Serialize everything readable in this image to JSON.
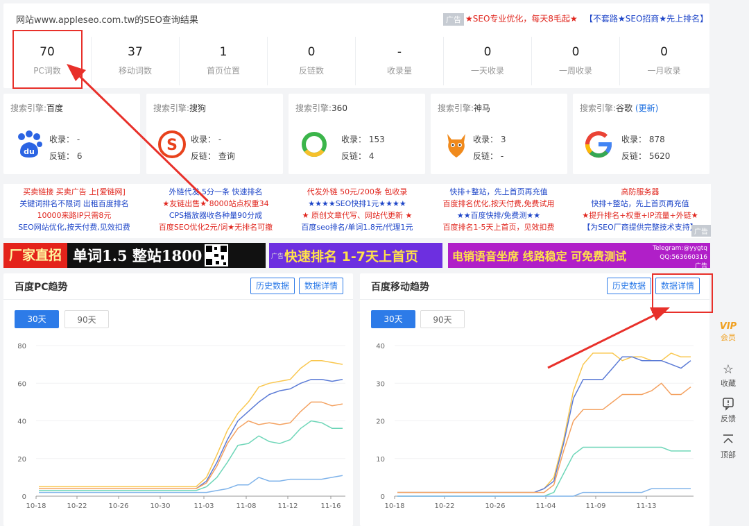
{
  "header": {
    "title": "网站www.appleseo.com.tw的SEO查询结果",
    "ad_tag": "广告",
    "ad1": "★SEO专业优化，每天8毛起★",
    "ad2": "【不套路★SEO招商★先上排名】"
  },
  "stats": [
    {
      "value": "70",
      "label": "PC词数"
    },
    {
      "value": "37",
      "label": "移动词数"
    },
    {
      "value": "1",
      "label": "首页位置"
    },
    {
      "value": "0",
      "label": "反链数"
    },
    {
      "value": "-",
      "label": "收录量"
    },
    {
      "value": "0",
      "label": "一天收录"
    },
    {
      "value": "0",
      "label": "一周收录"
    },
    {
      "value": "0",
      "label": "一月收录"
    }
  ],
  "engines": [
    {
      "prefix": "搜索引擎:",
      "name": "百度",
      "extra": "",
      "index": "收录： -",
      "links": "反链： 6",
      "icon": "baidu-icon"
    },
    {
      "prefix": "搜索引擎:",
      "name": "搜狗",
      "extra": "",
      "index": "收录： -",
      "links": "反链： 查询",
      "icon": "sogou-icon"
    },
    {
      "prefix": "搜索引擎:",
      "name": "360",
      "extra": "",
      "index": "收录： 153",
      "links": "反链： 4",
      "icon": "360-icon"
    },
    {
      "prefix": "搜索引擎:",
      "name": "神马",
      "extra": "",
      "index": "收录： 3",
      "links": "反链： -",
      "icon": "shenma-icon"
    },
    {
      "prefix": "搜索引擎:",
      "name": "谷歌",
      "extra": "(更新)",
      "index": "收录： 878",
      "links": "反链： 5620",
      "icon": "google-icon"
    }
  ],
  "ad_columns": [
    [
      "买卖链接 买卖广告 上[爱链网]",
      "关键词排名不限词 出租百度排名",
      "10000来路IP只需8元",
      "SEO网站优化,按天付费,见效扣费"
    ],
    [
      "外链代发 5分一条 快速排名",
      "★友链出售★ 8000站点权重34",
      "CPS播放器收各种量90分成",
      "百度SEO优化2元/词★无排名可撤"
    ],
    [
      "代发外链 50元/200条 包收录",
      "★★★★SEO快排1元★★★★",
      "★ 原创文章代写、网站代更新 ★",
      "百度seo排名/单词1.8元/代理1元"
    ],
    [
      "快排+整站，先上首页再充值",
      "百度排名优化,按天付费,免费试用",
      "★★百度快排/免费测★★",
      "百度排名1-5天上首页，见效扣费"
    ],
    [
      "高防服务器",
      "快排+整站，先上首页再充值",
      "★提升排名+权重+IP流量+外链★",
      "【为SEO厂商提供完整技术支持】"
    ]
  ],
  "ad_tag_bottom": "广告",
  "banners": {
    "b1a": "厂家直招",
    "b1b": "单词1.5 整站1800",
    "b2": "快速排名 1-7天上首页",
    "b3": "电销语音坐席 线路稳定 可免费测试",
    "b3_tel": "Telegram:@yygtq",
    "b3_qq": "QQ:563660316",
    "b3_ad": "广告",
    "b2_ad": "广告"
  },
  "pc_panel": {
    "title": "百度PC趋势",
    "btn_history": "历史数据",
    "btn_detail": "数据详情",
    "tab30": "30天",
    "tab90": "90天"
  },
  "mobile_panel": {
    "title": "百度移动趋势",
    "btn_history": "历史数据",
    "btn_detail": "数据详情",
    "tab30": "30天",
    "tab90": "90天"
  },
  "sidebar": {
    "vip": "VIP",
    "member": "会员",
    "favorite": "收藏",
    "feedback": "反馈",
    "top": "顶部"
  },
  "chart_data": [
    {
      "type": "line",
      "title": "百度PC趋势",
      "x": [
        "10-18",
        "10-22",
        "10-26",
        "10-30",
        "11-03",
        "11-08",
        "11-12",
        "11-16"
      ],
      "ylim": [
        0,
        80
      ],
      "yticks": [
        0,
        20,
        40,
        60,
        80
      ],
      "series": [
        {
          "color": "#f9c74f",
          "values": [
            5,
            5,
            5,
            5,
            5,
            5,
            5,
            5,
            5,
            5,
            5,
            5,
            5,
            5,
            5,
            5,
            10,
            22,
            35,
            44,
            50,
            58,
            60,
            61,
            62,
            68,
            72,
            72,
            71,
            70
          ]
        },
        {
          "color": "#5b7bd6",
          "values": [
            4,
            4,
            4,
            4,
            4,
            4,
            4,
            4,
            4,
            4,
            4,
            4,
            4,
            4,
            4,
            4,
            8,
            18,
            30,
            40,
            45,
            50,
            54,
            56,
            57,
            60,
            62,
            62,
            61,
            62
          ]
        },
        {
          "color": "#f4a261",
          "values": [
            4,
            4,
            4,
            4,
            4,
            4,
            4,
            4,
            4,
            4,
            4,
            4,
            4,
            4,
            4,
            4,
            7,
            16,
            28,
            36,
            40,
            38,
            39,
            38,
            39,
            45,
            50,
            50,
            48,
            49
          ]
        },
        {
          "color": "#6ed6b8",
          "values": [
            3,
            3,
            3,
            3,
            3,
            3,
            3,
            3,
            3,
            3,
            3,
            3,
            3,
            3,
            3,
            3,
            5,
            10,
            18,
            27,
            28,
            32,
            29,
            28,
            30,
            36,
            40,
            39,
            36,
            36
          ]
        },
        {
          "color": "#7fb3ea",
          "values": [
            2,
            2,
            2,
            2,
            2,
            2,
            2,
            2,
            2,
            2,
            2,
            2,
            2,
            2,
            2,
            2,
            2,
            3,
            4,
            6,
            6,
            10,
            8,
            8,
            9,
            9,
            9,
            9,
            10,
            11
          ]
        }
      ]
    },
    {
      "type": "line",
      "title": "百度移动趋势",
      "x": [
        "10-18",
        "10-22",
        "10-26",
        "11-04",
        "11-09",
        "11-13"
      ],
      "ylim": [
        0,
        40
      ],
      "yticks": [
        0,
        10,
        20,
        30,
        40
      ],
      "series": [
        {
          "color": "#f9c74f",
          "values": [
            1,
            1,
            1,
            1,
            1,
            1,
            1,
            1,
            1,
            1,
            1,
            1,
            1,
            1,
            1,
            2,
            5,
            15,
            28,
            35,
            38,
            38,
            38,
            36,
            37,
            37,
            36,
            36,
            38,
            37,
            37
          ]
        },
        {
          "color": "#5b7bd6",
          "values": [
            1,
            1,
            1,
            1,
            1,
            1,
            1,
            1,
            1,
            1,
            1,
            1,
            1,
            1,
            1,
            2,
            4,
            14,
            26,
            31,
            31,
            31,
            34,
            37,
            37,
            36,
            36,
            36,
            35,
            34,
            36
          ]
        },
        {
          "color": "#f4a261",
          "values": [
            1,
            1,
            1,
            1,
            1,
            1,
            1,
            1,
            1,
            1,
            1,
            1,
            1,
            1,
            1,
            1,
            3,
            12,
            20,
            23,
            23,
            23,
            25,
            27,
            27,
            27,
            28,
            30,
            27,
            27,
            29
          ]
        },
        {
          "color": "#6ed6b8",
          "values": [
            0,
            0,
            0,
            0,
            0,
            0,
            0,
            0,
            0,
            0,
            0,
            0,
            0,
            0,
            0,
            0,
            1,
            6,
            11,
            13,
            13,
            13,
            13,
            13,
            13,
            13,
            13,
            13,
            12,
            12,
            12
          ]
        },
        {
          "color": "#7fb3ea",
          "values": [
            0,
            0,
            0,
            0,
            0,
            0,
            0,
            0,
            0,
            0,
            0,
            0,
            0,
            0,
            0,
            0,
            0,
            0,
            0,
            1,
            1,
            1,
            1,
            1,
            1,
            1,
            2,
            2,
            2,
            2,
            2
          ]
        }
      ]
    }
  ]
}
